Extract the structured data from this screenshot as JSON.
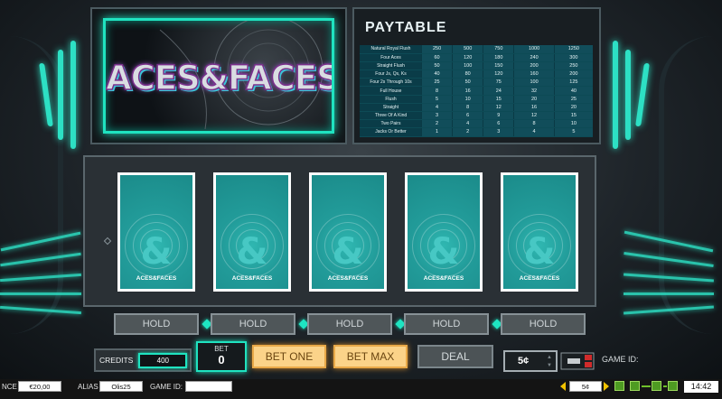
{
  "logo": {
    "text": "ACES&FACES"
  },
  "paytable": {
    "title": "PAYTABLE",
    "columns": [
      "250",
      "500",
      "750",
      "1000",
      "1250"
    ],
    "rows": [
      {
        "hand": "Natural Royal Flush",
        "values": [
          "250",
          "500",
          "750",
          "1000",
          "1250"
        ]
      },
      {
        "hand": "Four Aces",
        "values": [
          "60",
          "120",
          "180",
          "240",
          "300"
        ]
      },
      {
        "hand": "Straight Flush",
        "values": [
          "50",
          "100",
          "150",
          "200",
          "250"
        ]
      },
      {
        "hand": "Four Js, Qs, Ks",
        "values": [
          "40",
          "80",
          "120",
          "160",
          "200"
        ]
      },
      {
        "hand": "Four 2s Through 10s",
        "values": [
          "25",
          "50",
          "75",
          "100",
          "125"
        ]
      },
      {
        "hand": "Full House",
        "values": [
          "8",
          "16",
          "24",
          "32",
          "40"
        ]
      },
      {
        "hand": "Flush",
        "values": [
          "5",
          "10",
          "15",
          "20",
          "25"
        ]
      },
      {
        "hand": "Straight",
        "values": [
          "4",
          "8",
          "12",
          "16",
          "20"
        ]
      },
      {
        "hand": "Three Of A Kind",
        "values": [
          "3",
          "6",
          "9",
          "12",
          "15"
        ]
      },
      {
        "hand": "Two Pairs",
        "values": [
          "2",
          "4",
          "6",
          "8",
          "10"
        ]
      },
      {
        "hand": "Jacks Or Better",
        "values": [
          "1",
          "2",
          "3",
          "4",
          "5"
        ]
      }
    ]
  },
  "cards": [
    {
      "label": "ACES&FACES"
    },
    {
      "label": "ACES&FACES"
    },
    {
      "label": "ACES&FACES"
    },
    {
      "label": "ACES&FACES"
    },
    {
      "label": "ACES&FACES"
    }
  ],
  "holds": [
    "HOLD",
    "HOLD",
    "HOLD",
    "HOLD",
    "HOLD"
  ],
  "controls": {
    "credits_label": "CREDITS",
    "credits_value": "400",
    "bet_label": "BET",
    "bet_value": "0",
    "bet_one": "BET ONE",
    "bet_max": "BET MAX",
    "deal": "DEAL",
    "denomination": "5¢",
    "game_id_label": "GAME ID:"
  },
  "statusbar": {
    "balance_label": "NCE",
    "balance_value": "€20,00",
    "alias_label": "ALIAS",
    "alias_value": "Olis25",
    "game_id_label": "GAME ID:",
    "game_id_value": "",
    "denom_value": "5¢",
    "clock": "14:42"
  },
  "colors": {
    "accent": "#1fe3c0",
    "card_back": "#229c9a",
    "gold_button": "#fbd389",
    "paytable_cell": "#114d5a"
  }
}
